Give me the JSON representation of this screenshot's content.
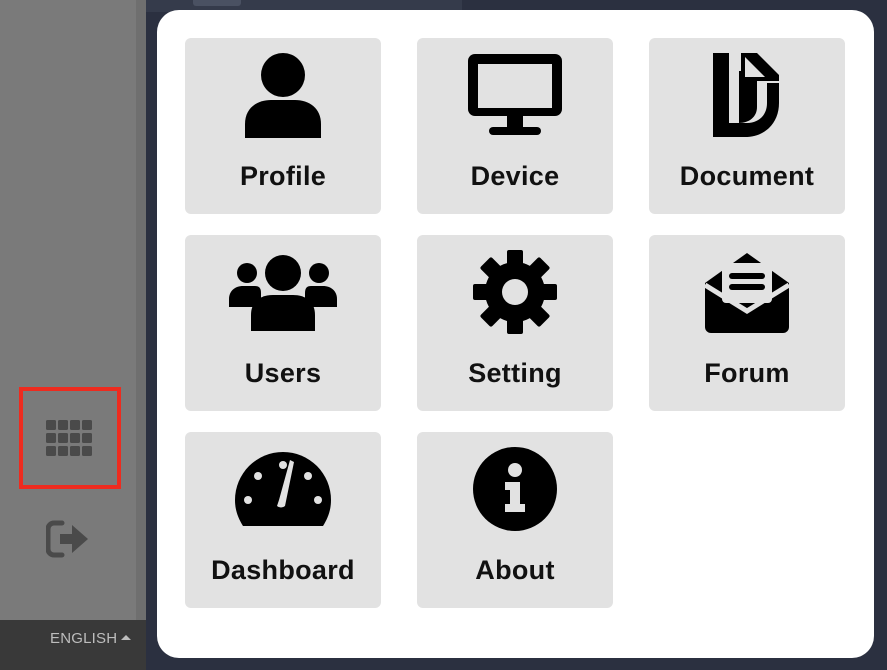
{
  "sidebar": {
    "language": "ENGLISH",
    "apps_icon": "grid-icon",
    "logout_icon": "logout-icon"
  },
  "menu": {
    "items": [
      {
        "label": "Profile",
        "icon": "user-icon"
      },
      {
        "label": "Device",
        "icon": "monitor-icon"
      },
      {
        "label": "Document",
        "icon": "document-icon"
      },
      {
        "label": "Users",
        "icon": "users-icon"
      },
      {
        "label": "Setting",
        "icon": "gear-icon"
      },
      {
        "label": "Forum",
        "icon": "envelope-icon"
      },
      {
        "label": "Dashboard",
        "icon": "gauge-icon"
      },
      {
        "label": "About",
        "icon": "info-icon"
      }
    ]
  },
  "colors": {
    "highlight": "#ee2b1f",
    "tile": "#e2e2e2",
    "panel": "#ffffff"
  }
}
